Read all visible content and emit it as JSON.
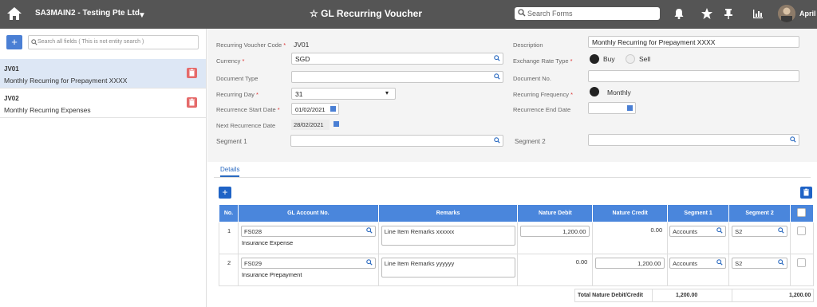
{
  "topbar": {
    "company": "SA3MAIN2 - Testing Pte Ltd",
    "title": "GL Recurring Voucher",
    "search_placeholder": "Search Forms",
    "user": "April"
  },
  "sidebar": {
    "search_placeholder": "Search all fields ( This is not entity search )",
    "items": [
      {
        "code": "JV01",
        "desc": "Monthly Recurring for Prepayment XXXX"
      },
      {
        "code": "JV02",
        "desc": "Monthly Recurring Expenses"
      }
    ]
  },
  "form": {
    "recurring_voucher_code_label": "Recurring Voucher Code",
    "recurring_voucher_code": "JV01",
    "description_label": "Description",
    "description": "Monthly Recurring for Prepayment XXXX",
    "currency_label": "Currency",
    "currency": "SGD",
    "exchange_rate_type_label": "Exchange Rate Type",
    "buy_label": "Buy",
    "sell_label": "Sell",
    "document_type_label": "Document Type",
    "document_no_label": "Document No.",
    "recurring_day_label": "Recurring Day",
    "recurring_day": "31",
    "recurring_frequency_label": "Recurring Frequency",
    "frequency": "Monthly",
    "recurrence_start_label": "Recurrence Start Date",
    "recurrence_start": "01/02/2021",
    "recurrence_end_label": "Recurrence End Date",
    "next_recurrence_label": "Next Recurrence Date",
    "next_recurrence": "28/02/2021",
    "segment1_label": "Segment 1",
    "segment2_label": "Segment 2"
  },
  "details": {
    "tab": "Details",
    "columns": [
      "No.",
      "GL Account No.",
      "Remarks",
      "Nature Debit",
      "Nature Credit",
      "Segment 1",
      "Segment 2"
    ],
    "rows": [
      {
        "no": "1",
        "account": "FS028",
        "account_name": "Insurance Expense",
        "remarks": "Line Item Remarks xxxxxx",
        "debit": "1,200.00",
        "credit": "0.00",
        "seg1": "Accounts",
        "seg2": "S2"
      },
      {
        "no": "2",
        "account": "FS029",
        "account_name": "Insurance Prepayment",
        "remarks": "Line Item Remarks yyyyyy",
        "debit": "0.00",
        "credit": "1,200.00",
        "seg1": "Accounts",
        "seg2": "S2"
      }
    ],
    "total_label": "Total Nature Debit/Credit",
    "total_debit": "1,200.00",
    "total_credit": "1,200.00"
  }
}
